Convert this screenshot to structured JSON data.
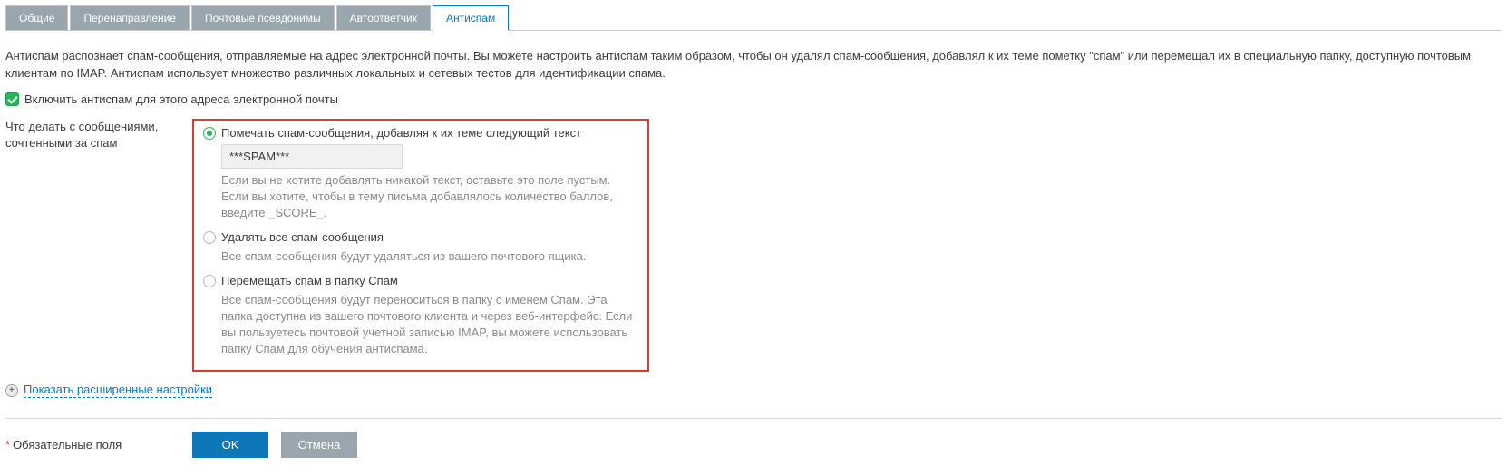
{
  "tabs": [
    {
      "label": "Общие"
    },
    {
      "label": "Перенаправление"
    },
    {
      "label": "Почтовые псевдонимы"
    },
    {
      "label": "Автоответчик"
    },
    {
      "label": "Антиспам"
    }
  ],
  "intro": "Антиспам распознает спам-сообщения, отправляемые на адрес электронной почты. Вы можете настроить антиспам таким образом, чтобы он удалял спам-сообщения, добавлял к их теме пометку \"спам\" или перемещал их в специальную папку, доступную почтовым клиентам по IMAP. Антиспам использует множество различных локальных и сетевых тестов для идентификации спама.",
  "enable_label": "Включить антиспам для этого адреса электронной почты",
  "action_label": "Что делать с сообщениями, сочтенными за спам",
  "options": {
    "mark": {
      "label": "Помечать спам-сообщения, добавляя к их теме следующий текст",
      "value": "***SPAM***",
      "hint": "Если вы не хотите добавлять никакой текст, оставьте это поле пустым. Если вы хотите, чтобы в тему письма добавлялось количество баллов, введите _SCORE_."
    },
    "delete": {
      "label": "Удалять все спам-сообщения",
      "hint": "Все спам-сообщения будут удаляться из вашего почтового ящика."
    },
    "move": {
      "label": "Перемещать спам в папку Спам",
      "hint": "Все спам-сообщения будут переноситься в папку с именем Спам. Эта папка доступна из вашего почтового клиента и через веб-интерфейс. Если вы пользуетесь почтовой учетной записью IMAP, вы можете использовать папку Спам для обучения антиспама."
    }
  },
  "advanced_toggle": "Показать расширенные настройки",
  "required_note": "Обязательные поля",
  "buttons": {
    "ok": "OK",
    "cancel": "Отмена"
  }
}
